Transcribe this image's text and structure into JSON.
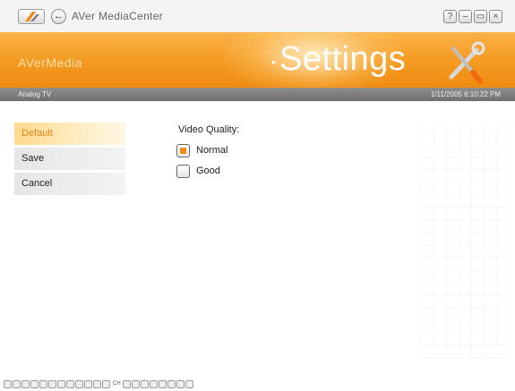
{
  "window": {
    "title": "AVer MediaCenter",
    "controls": [
      "?",
      "–",
      "▭",
      "×"
    ]
  },
  "banner": {
    "brand": "AVerMedia",
    "section_title": "Settings",
    "section_arrow": "▸"
  },
  "status": {
    "source": "Analog TV",
    "datetime": "1/11/2005 6:10:22 PM"
  },
  "menu": {
    "items": [
      {
        "label": "Default",
        "selected": true
      },
      {
        "label": "Save",
        "selected": false
      },
      {
        "label": "Cancel",
        "selected": false
      }
    ]
  },
  "video_quality": {
    "label": "Video Quality:",
    "options": [
      {
        "label": "Normal",
        "checked": true
      },
      {
        "label": "Good",
        "checked": false
      }
    ]
  },
  "bottom_bar": {
    "label": "CH"
  },
  "colors": {
    "accent": "#f08a10",
    "selected_text": "#e6841a"
  },
  "icons": {
    "logo": "play-logo-icon",
    "back": "back-arrow-icon",
    "section": "tools-wrench-screwdriver-icon"
  }
}
